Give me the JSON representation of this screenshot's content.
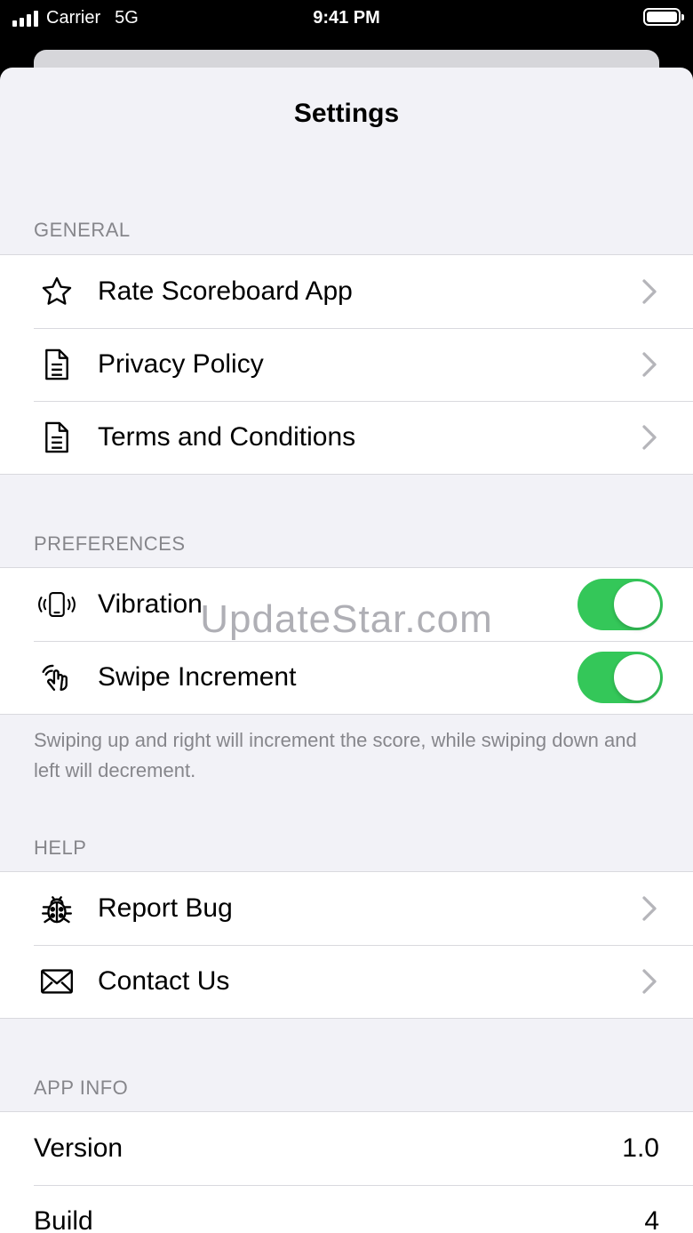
{
  "status_bar": {
    "carrier": "Carrier",
    "network": "5G",
    "time": "9:41 PM"
  },
  "title": "Settings",
  "sections": {
    "general": {
      "header": "GENERAL",
      "items": [
        {
          "label": "Rate Scoreboard App",
          "icon": "star-icon"
        },
        {
          "label": "Privacy Policy",
          "icon": "document-icon"
        },
        {
          "label": "Terms and Conditions",
          "icon": "document-icon"
        }
      ]
    },
    "preferences": {
      "header": "PREFERENCES",
      "items": [
        {
          "label": "Vibration",
          "icon": "vibration-icon",
          "on": true
        },
        {
          "label": "Swipe Increment",
          "icon": "swipe-hand-icon",
          "on": true
        }
      ],
      "footer": "Swiping up and right will increment the score, while swiping down and left will decrement."
    },
    "help": {
      "header": "HELP",
      "items": [
        {
          "label": "Report Bug",
          "icon": "ladybug-icon"
        },
        {
          "label": "Contact Us",
          "icon": "envelope-icon"
        }
      ]
    },
    "app_info": {
      "header": "APP INFO",
      "items": [
        {
          "label": "Version",
          "value": "1.0"
        },
        {
          "label": "Build",
          "value": "4"
        }
      ]
    }
  },
  "watermark": "UpdateStar.com",
  "colors": {
    "toggle_on": "#34c759",
    "background": "#f2f2f7",
    "section_text": "#86868b"
  }
}
